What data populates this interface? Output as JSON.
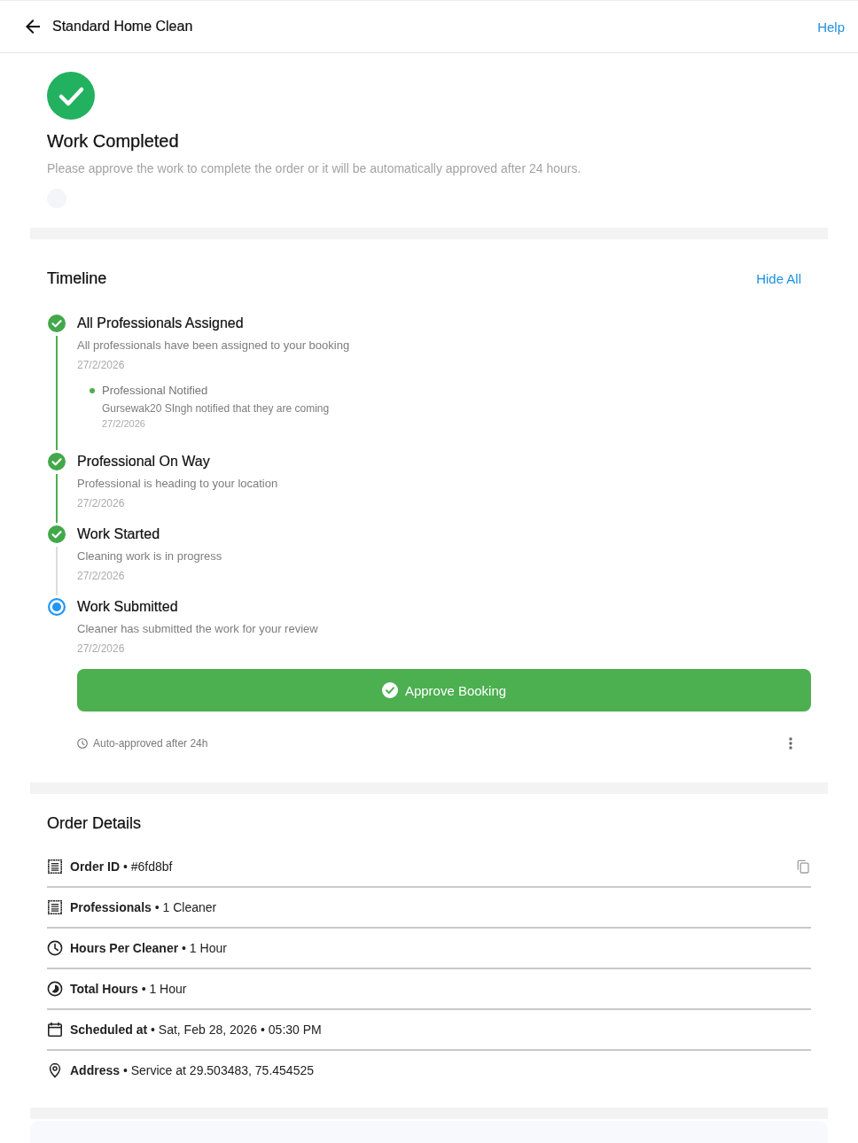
{
  "header": {
    "title": "Standard Home Clean",
    "help_link": "Help"
  },
  "status": {
    "title": "Work Completed",
    "message": "Please approve the work to complete the order or it will be automatically approved after 24 hours."
  },
  "timeline": {
    "title": "Timeline",
    "toggle_link": "Hide All",
    "steps": [
      {
        "title": "All Professionals Assigned",
        "description": "All professionals have been assigned to your booking",
        "date": "27/2/2026",
        "completed": true,
        "events": [
          {
            "title": "Professional Notified",
            "detail": "Gursewak20 SIngh notified that they are coming",
            "date": "27/2/2026"
          }
        ]
      },
      {
        "title": "Professional On Way",
        "description": "Professional is heading to your location",
        "date": "27/2/2026",
        "completed": true
      },
      {
        "title": "Work Started",
        "description": "Cleaning work is in progress",
        "date": "27/2/2026",
        "completed": true
      },
      {
        "title": "Work Submitted",
        "description": "Cleaner has submitted the work for your review",
        "date": "27/2/2026",
        "completed": false
      }
    ],
    "approve_button": "Approve Booking",
    "auto_approve_note": "Auto-approved after 24h"
  },
  "order_details": {
    "title": "Order Details",
    "rows": [
      {
        "kind": "document",
        "text": "**Order ID** • #6fd8bf",
        "copyable": true
      },
      {
        "kind": "document",
        "text": "**Professionals** • 1 Cleaner",
        "copyable": false
      },
      {
        "kind": "clock",
        "text": "**Hours Per Cleaner** • 1 Hour",
        "copyable": false
      },
      {
        "kind": "timelapse",
        "text": "**Total Hours** • 1 Hour",
        "copyable": false
      },
      {
        "kind": "calendar",
        "text": "**Scheduled at** • Sat, Feb 28, 2026 • 05:30 PM",
        "copyable": false
      },
      {
        "kind": "pin",
        "text": "**Address** • Service at 29.503483, 75.454525",
        "copyable": false
      }
    ]
  }
}
